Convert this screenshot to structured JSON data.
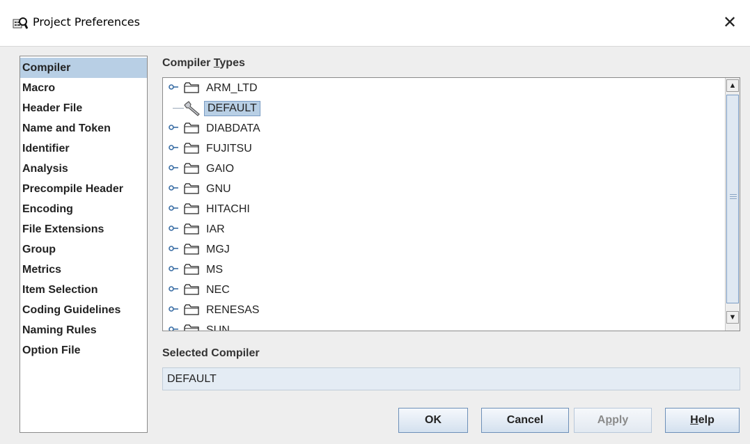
{
  "window": {
    "title": "Project Preferences",
    "close_symbol": "✕"
  },
  "sidebar": {
    "items": [
      {
        "label": "Compiler",
        "selected": true
      },
      {
        "label": "Macro"
      },
      {
        "label": "Header File"
      },
      {
        "label": "Name and Token"
      },
      {
        "label": "Identifier"
      },
      {
        "label": "Analysis"
      },
      {
        "label": "Precompile Header"
      },
      {
        "label": "Encoding"
      },
      {
        "label": "File Extensions"
      },
      {
        "label": "Group"
      },
      {
        "label": "Metrics"
      },
      {
        "label": "Item Selection"
      },
      {
        "label": "Coding Guidelines"
      },
      {
        "label": "Naming Rules"
      },
      {
        "label": "Option File"
      }
    ]
  },
  "compiler_types": {
    "label_pre": "Compiler ",
    "label_mnemonic": "T",
    "label_post": "ypes",
    "nodes": [
      {
        "label": "ARM_LTD",
        "kind": "folder"
      },
      {
        "label": "DEFAULT",
        "kind": "leaf",
        "selected": true
      },
      {
        "label": "DIABDATA",
        "kind": "folder"
      },
      {
        "label": "FUJITSU",
        "kind": "folder"
      },
      {
        "label": "GAIO",
        "kind": "folder"
      },
      {
        "label": "GNU",
        "kind": "folder"
      },
      {
        "label": "HITACHI",
        "kind": "folder"
      },
      {
        "label": "IAR",
        "kind": "folder"
      },
      {
        "label": "MGJ",
        "kind": "folder"
      },
      {
        "label": "MS",
        "kind": "folder"
      },
      {
        "label": "NEC",
        "kind": "folder"
      },
      {
        "label": "RENESAS",
        "kind": "folder"
      },
      {
        "label": "SUN",
        "kind": "folder"
      }
    ]
  },
  "selected_compiler": {
    "label": "Selected Compiler",
    "value": "DEFAULT"
  },
  "buttons": {
    "ok": "OK",
    "cancel": "Cancel",
    "apply_pre": "A",
    "apply_mnemonic": "p",
    "apply_post": "ply",
    "help_mnemonic": "H",
    "help_post": "elp"
  },
  "colors": {
    "selection": "#b8cfe5",
    "button_border": "#6c8fb8",
    "field_bg": "#e4ecf4"
  },
  "icons": [
    "preferences-icon",
    "close-icon",
    "folder-icon",
    "wrench-icon",
    "expand-handle-icon",
    "scroll-up-icon",
    "scroll-down-icon"
  ]
}
